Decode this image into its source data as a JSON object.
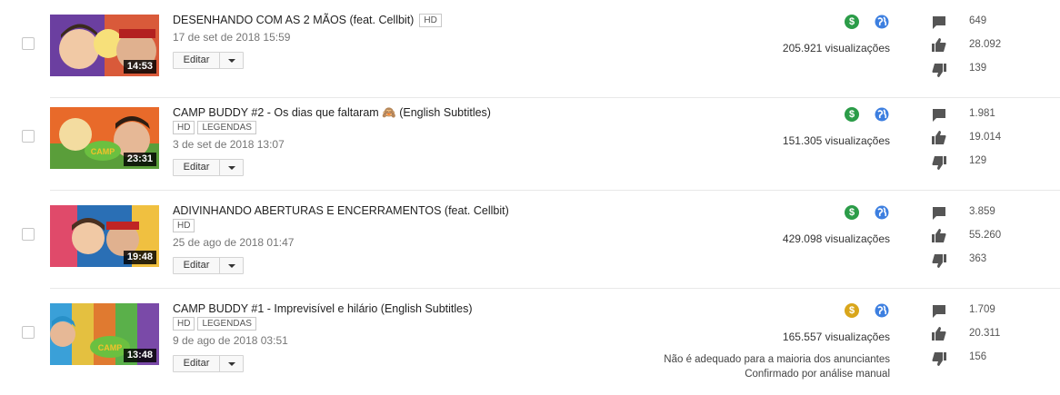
{
  "videos": [
    {
      "title": "DESENHANDO COM AS 2 MÃOS (feat. Cellbit)",
      "badges": [
        "HD"
      ],
      "date": "17 de set de 2018 15:59",
      "duration": "14:53",
      "edit_label": "Editar",
      "monetization": "green",
      "views": "205.921 visualizações",
      "comments": "649",
      "likes": "28.092",
      "dislikes": "139"
    },
    {
      "title": "CAMP BUDDY #2 - Os dias que faltaram 🙈 (English Subtitles)",
      "badges": [
        "HD",
        "LEGENDAS"
      ],
      "date": "3 de set de 2018 13:07",
      "duration": "23:31",
      "edit_label": "Editar",
      "monetization": "green",
      "views": "151.305 visualizações",
      "comments": "1.981",
      "likes": "19.014",
      "dislikes": "129"
    },
    {
      "title": "ADIVINHANDO ABERTURAS E ENCERRAMENTOS (feat. Cellbit)",
      "badges": [
        "HD"
      ],
      "date": "25 de ago de 2018 01:47",
      "duration": "19:48",
      "edit_label": "Editar",
      "monetization": "green",
      "views": "429.098 visualizações",
      "comments": "3.859",
      "likes": "55.260",
      "dislikes": "363"
    },
    {
      "title": "CAMP BUDDY #1 - Imprevisível e hilário (English Subtitles)",
      "badges": [
        "HD",
        "LEGENDAS"
      ],
      "date": "9 de ago de 2018 03:51",
      "duration": "13:48",
      "edit_label": "Editar",
      "monetization": "yellow",
      "views": "165.557 visualizações",
      "notice_line1": "Não é adequado para a maioria dos anunciantes",
      "notice_line2": "Confirmado por análise manual",
      "comments": "1.709",
      "likes": "20.311",
      "dislikes": "156"
    }
  ],
  "colors": {
    "monetized": "#2b9c48",
    "limited": "#d9a61b",
    "globe": "#3d7fe0"
  }
}
